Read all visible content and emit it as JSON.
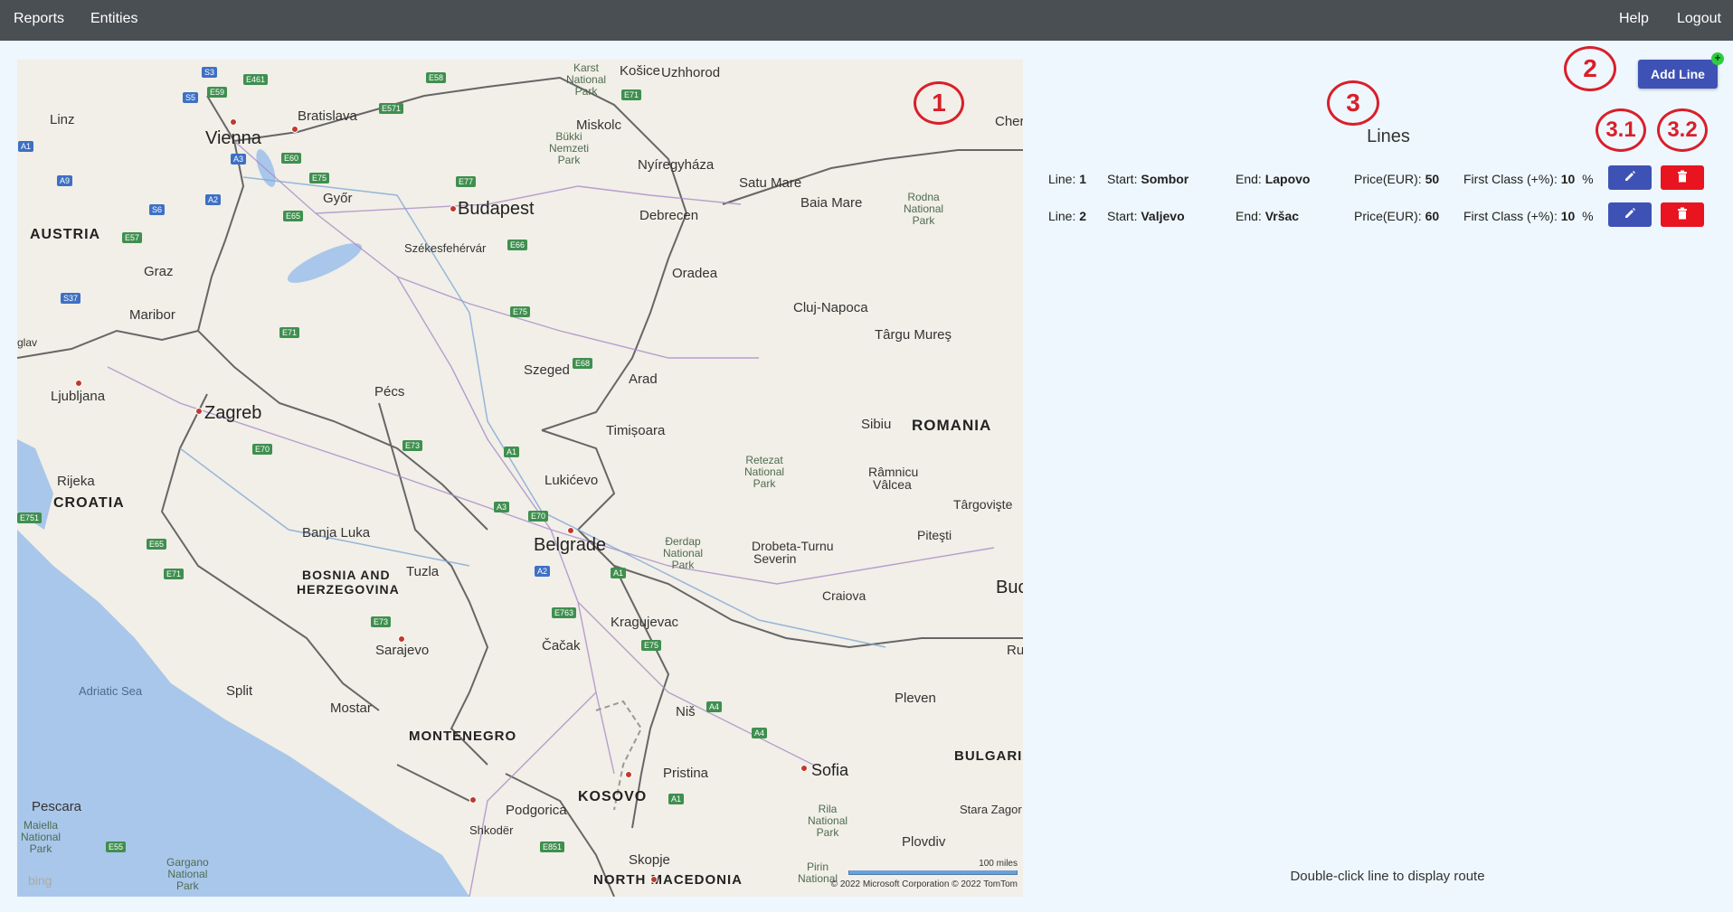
{
  "nav": {
    "reports": "Reports",
    "entities": "Entities",
    "help": "Help",
    "logout": "Logout"
  },
  "map": {
    "labels": {
      "vienna": "Vienna",
      "bratislava": "Bratislava",
      "budapest": "Budapest",
      "austria": "AUSTRIA",
      "graz": "Graz",
      "gyor": "Győr",
      "linz": "Linz",
      "szekesfehervar": "Székesfehérvár",
      "kosice": "Košice",
      "uzhhorod": "Uzhhorod",
      "miskolc": "Miskolc",
      "nyiregyhaza": "Nyíregyháza",
      "debrecen": "Debrecen",
      "satu_mare": "Satu Mare",
      "baia_mare": "Baia Mare",
      "oradea": "Oradea",
      "cluj": "Cluj-Napoca",
      "targu_mures": "Târgu Mureş",
      "maribor": "Maribor",
      "ljubljana": "Ljubljana",
      "zagreb": "Zagreb",
      "pecs": "Pécs",
      "szeged": "Szeged",
      "arad": "Arad",
      "timisoara": "Timișoara",
      "romania": "ROMANIA",
      "sibiu": "Sibiu",
      "rijeka": "Rijeka",
      "croatia": "CROATIA",
      "lukicevo": "Lukićevo",
      "belgrade": "Belgrade",
      "banja_luka": "Banja Luka",
      "tuzla": "Tuzla",
      "bih_1": "BOSNIA AND",
      "bih_2": "HERZEGOVINA",
      "drobeta_1": "Drobeta-Turnu",
      "drobeta_2": "Severin",
      "ramnicu_1": "Râmnicu",
      "ramnicu_2": "Vâlcea",
      "targoviste": "Târgovişte",
      "pitesti": "Piteşti",
      "craiova": "Craiova",
      "kragujevac": "Kragujevac",
      "cacak": "Čačak",
      "sarajevo": "Sarajevo",
      "split": "Split",
      "adriatic": "Adriatic Sea",
      "mostar": "Mostar",
      "montenegro": "MONTENEGRO",
      "nis": "Niš",
      "pristina": "Pristina",
      "kosovo": "KOSOVO",
      "sofia": "Sofia",
      "pleven": "Pleven",
      "bulgaria": "BULGARIA",
      "podgorica": "Podgorica",
      "shkoder": "Shkodër",
      "pescara": "Pescara",
      "skopje": "Skopje",
      "north_macedonia": "NORTH MACEDONIA",
      "stara_zagora": "Stara Zagor",
      "plovdiv": "Plovdiv",
      "buc": "Buc",
      "ru": "Ru",
      "cherr": "Cherr",
      "glav": "glav",
      "karst_1": "Karst",
      "karst_2": "National",
      "karst_3": "Park",
      "bukki_1": "Bükki",
      "bukki_2": "Nemzeti",
      "bukki_3": "Park",
      "rodna_1": "Rodna",
      "rodna_2": "National",
      "rodna_3": "Park",
      "retezat_1": "Retezat",
      "retezat_2": "National",
      "retezat_3": "Park",
      "derdap_1": "Đerdap",
      "derdap_2": "National",
      "derdap_3": "Park",
      "rila_1": "Rila",
      "rila_2": "National",
      "rila_3": "Park",
      "pirin_1": "Pirin",
      "pirin_2": "National",
      "maiella_1": "Maiella",
      "maiella_2": "National",
      "maiella_3": "Park",
      "gargano_1": "Gargano",
      "gargano_2": "National",
      "gargano_3": "Park"
    },
    "scale": "100 miles",
    "copyright": "© 2022 Microsoft Corporation   © 2022 TomTom",
    "bing": "bing",
    "shields": [
      "S3",
      "E461",
      "E58",
      "E571",
      "E71",
      "S5",
      "E59",
      "E60",
      "E75",
      "E77",
      "A3",
      "A9",
      "S6",
      "A2",
      "E57",
      "E65",
      "E66",
      "S37",
      "A1",
      "E71",
      "E68",
      "E75",
      "E73",
      "E70",
      "A1",
      "A3",
      "E70",
      "A2",
      "A1",
      "E763",
      "E75",
      "E73",
      "E65",
      "E71",
      "A4",
      "A4",
      "A1",
      "E851",
      "E55",
      "E751"
    ]
  },
  "annotations": {
    "a1": "1",
    "a2": "2",
    "a3": "3",
    "a31": "3.1",
    "a32": "3.2"
  },
  "panel": {
    "add_line": "Add Line",
    "plus": "+",
    "lines_title": "Lines",
    "hint": "Double-click line to display route",
    "labels": {
      "line": "Line:",
      "start": "Start:",
      "end": "End:",
      "price": "Price(EUR):",
      "first_class": "First Class (+%):",
      "percent": "%"
    },
    "lines": [
      {
        "id": "1",
        "start": "Sombor",
        "end": "Lapovo",
        "price": "50",
        "first_class": "10"
      },
      {
        "id": "2",
        "start": "Valjevo",
        "end": "Vršac",
        "price": "60",
        "first_class": "10"
      }
    ]
  },
  "colors": {
    "navbar": "#4a4f54",
    "primary": "#3e52b5",
    "danger": "#e8141f",
    "annotation": "#d91f2a",
    "background": "#eef7fd"
  }
}
